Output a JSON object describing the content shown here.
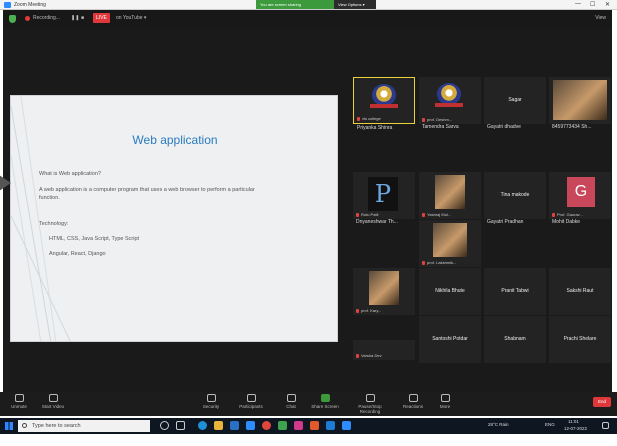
{
  "window": {
    "title": "Zoom Meeting",
    "sharing_label": "You are screen sharing",
    "view_options": "View Options ▾",
    "controls": [
      "—",
      "☐",
      "✕"
    ]
  },
  "meeting_bar": {
    "recording_label": "Recording...",
    "live_badge": "LIVE",
    "youtube_label": "on YouTube ▾",
    "view_label": "View"
  },
  "slide": {
    "title": "Web application",
    "lines": [
      "What is Web application?",
      "A web application is a computer program that uses a web browser to perform a particular",
      "function.",
      "Technology:",
      "HTML, CSS, Java Script, Type Script",
      "Angular, React, Django"
    ]
  },
  "participants": [
    {
      "name": "Priyanka  Shinra",
      "sub": "vls college",
      "kind": "logo"
    },
    {
      "name": "Tamendra Sarva",
      "sub": "prof. Deshm...",
      "kind": "logo"
    },
    {
      "name": "Gayatri dhadve",
      "center": "Sagar",
      "kind": "text"
    },
    {
      "name": "8459773434 Sh...",
      "kind": "photo"
    },
    {
      "name": "Dnyaneshwar Th...",
      "sub": "Rutu Patil",
      "kind": "letter",
      "letter": "P"
    },
    {
      "name": "Yashraj Mul...",
      "sub": "Yashraj Mul...",
      "kind": "photo"
    },
    {
      "name": "Gayatri Pradhan",
      "center": "Tina makode",
      "kind": "text"
    },
    {
      "name": "Mohit Dabke",
      "sub": "Prof. Gaurav...",
      "kind": "avatar",
      "letter": "G"
    },
    {
      "name": "",
      "sub": "prof. Lakshmik...",
      "kind": "photo"
    },
    {
      "name": "Nikhila Bhute",
      "kind": "text"
    },
    {
      "name": "Pranit Tabwi",
      "kind": "text"
    },
    {
      "name": "Sakshi Raut",
      "kind": "text"
    },
    {
      "name": "",
      "sub": "prof. Kary...",
      "kind": "photo"
    },
    {
      "name": "Santoshi Potdar",
      "kind": "text"
    },
    {
      "name": "Shabnam",
      "kind": "text"
    },
    {
      "name": "Prachi Shelare",
      "kind": "text"
    },
    {
      "name": "Varsha Dev",
      "kind": "text"
    }
  ],
  "control_bar": {
    "items": [
      "Unmute",
      "Start Video",
      "Security",
      "Participants",
      "Chat",
      "Share Screen",
      "Pause/Stop Recording",
      "Reactions",
      "More"
    ],
    "end_label": "End"
  },
  "taskbar": {
    "search_placeholder": "Type here to search",
    "weather": "28°C Rain",
    "lang": "ENG",
    "time": "11:01",
    "date": "12-07-2022"
  }
}
